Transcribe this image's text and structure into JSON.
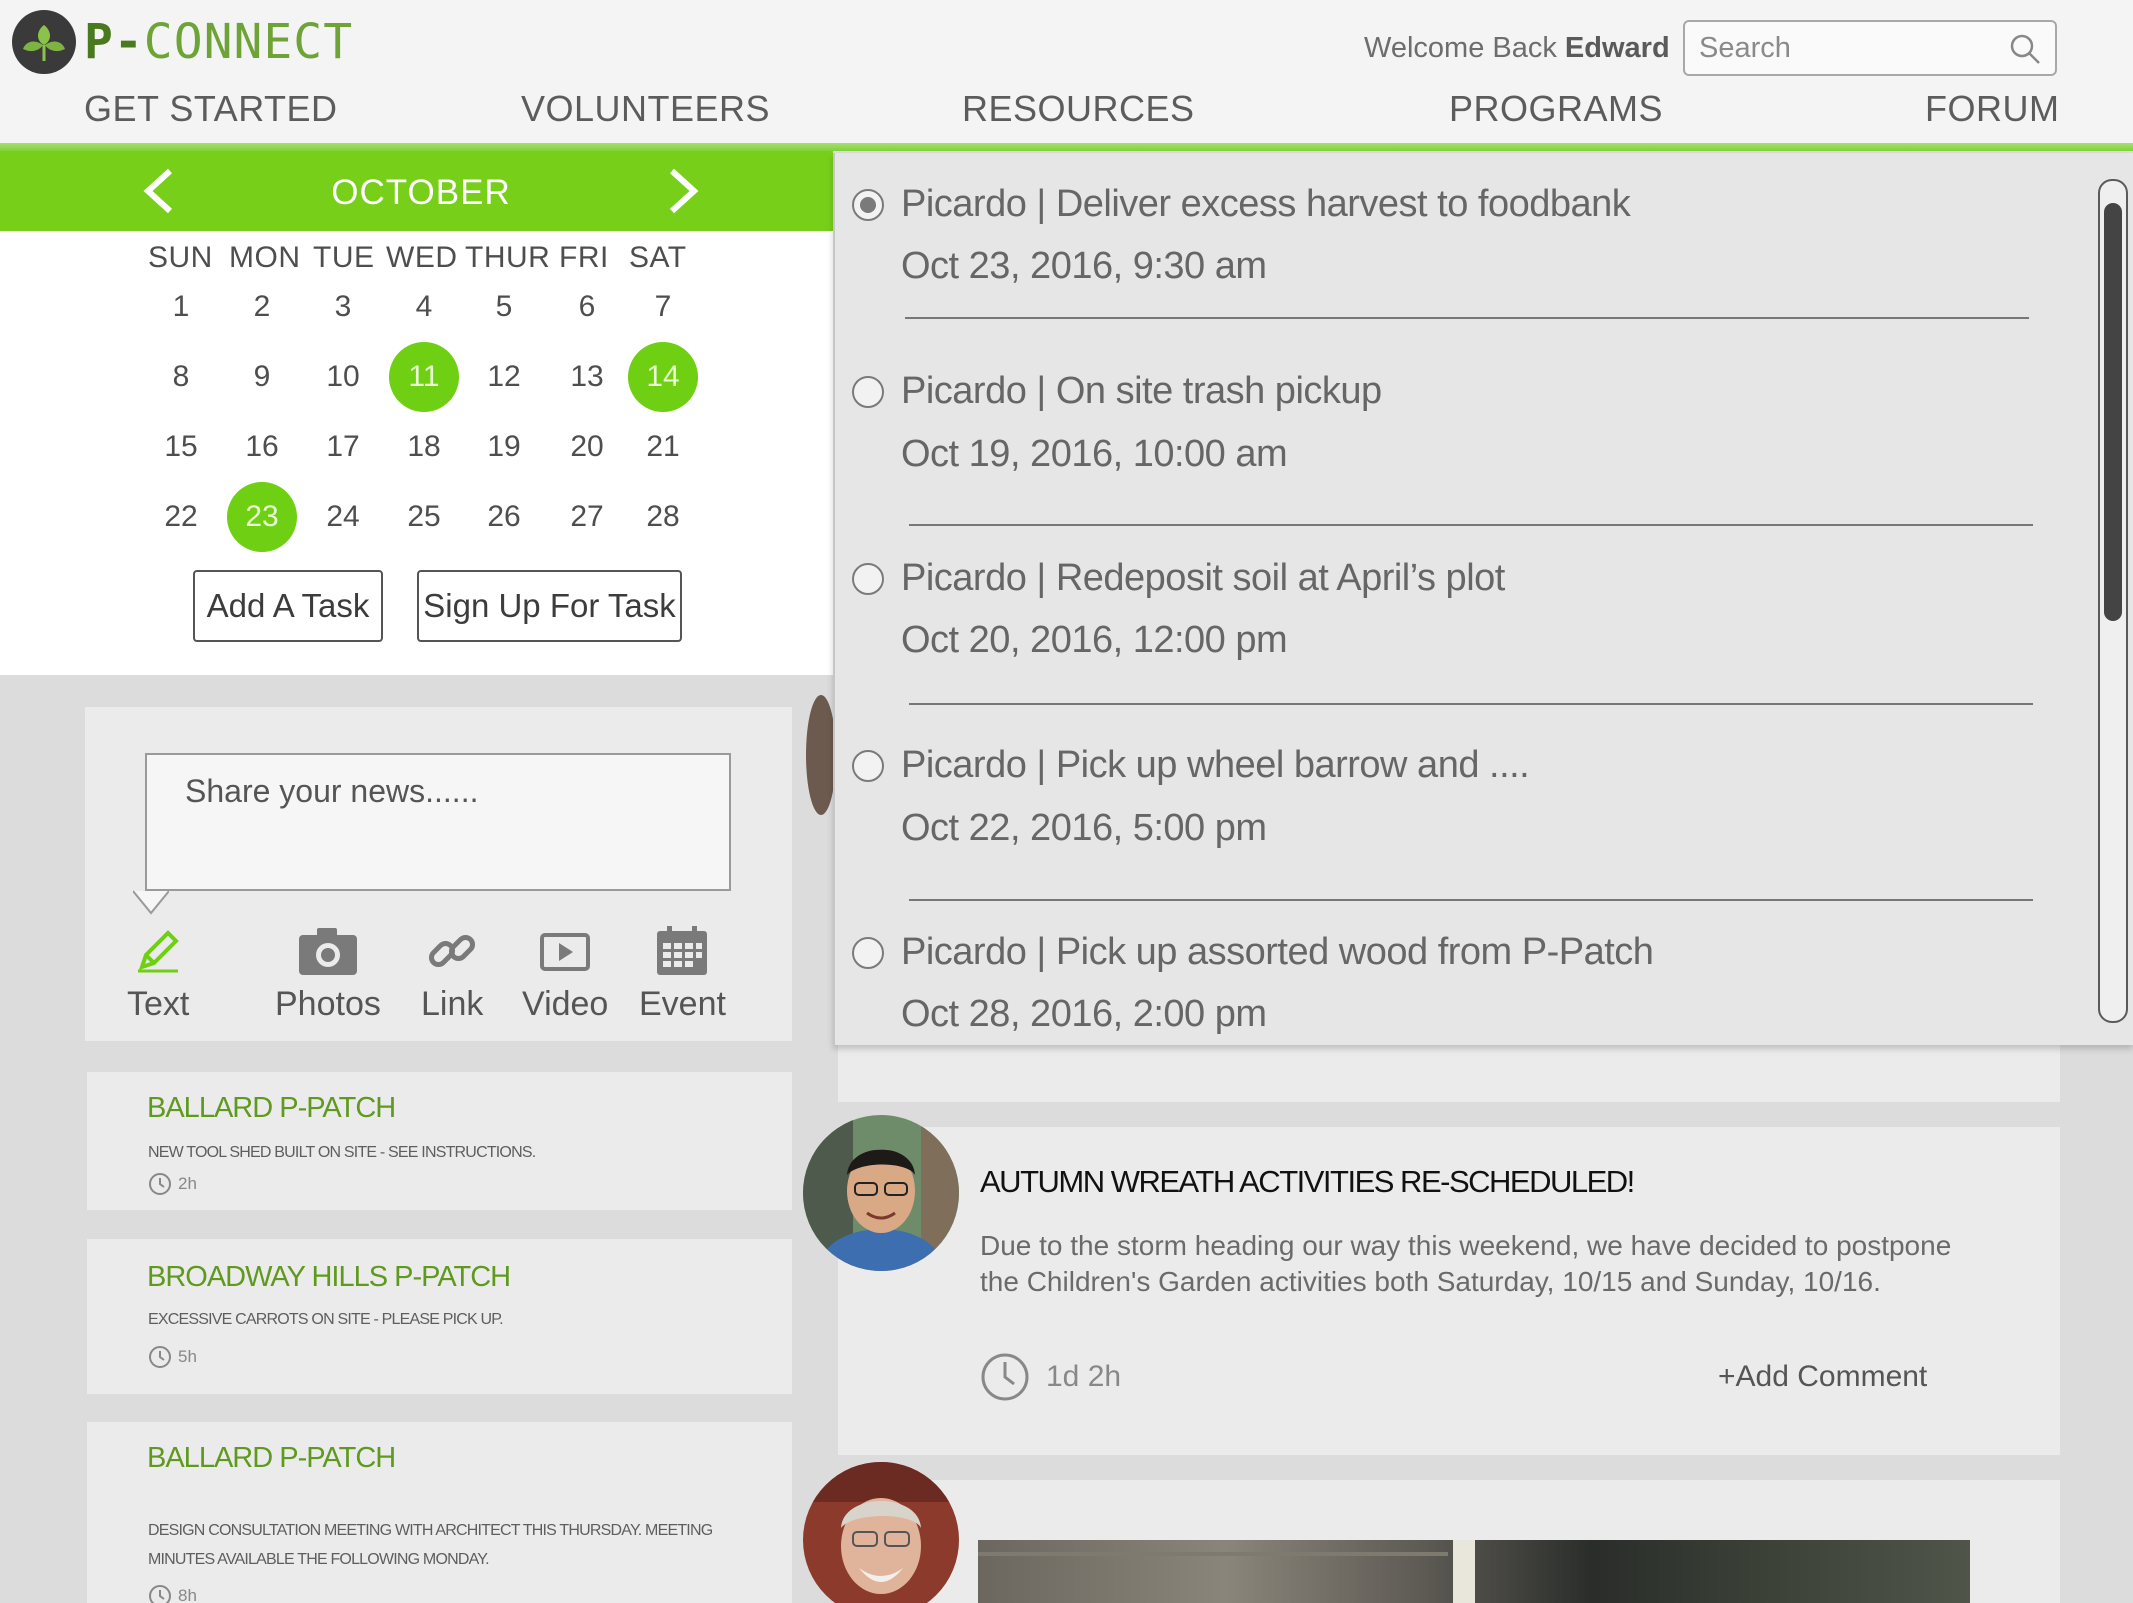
{
  "brand": {
    "name_prefix": "P-",
    "name_rest": "CONNECT",
    "logo_icon": "leaf-icon",
    "accent": "#77cf1a"
  },
  "header": {
    "welcome_prefix": "Welcome Back ",
    "user_name": "Edward",
    "search_placeholder": "Search",
    "nav": [
      "GET STARTED",
      "VOLUNTEERS",
      "RESOURCES",
      "PROGRAMS",
      "FORUM"
    ]
  },
  "calendar": {
    "month": "OCTOBER",
    "weekdays": [
      "SUN",
      "MON",
      "TUE",
      "WED",
      "THUR",
      "FRI",
      "SAT"
    ],
    "weeks": [
      [
        "1",
        "2",
        "3",
        "4",
        "5",
        "6",
        "7"
      ],
      [
        "8",
        "9",
        "10",
        "11",
        "12",
        "13",
        "14"
      ],
      [
        "15",
        "16",
        "17",
        "18",
        "19",
        "20",
        "21"
      ],
      [
        "22",
        "23",
        "24",
        "25",
        "26",
        "27",
        "28"
      ]
    ],
    "highlighted_days": [
      "11",
      "14",
      "23"
    ],
    "add_task_label": "Add A Task",
    "sign_up_label": "Sign Up For Task"
  },
  "composer": {
    "placeholder": "Share your news......",
    "actions": [
      {
        "label": "Text",
        "icon": "pencil-icon"
      },
      {
        "label": "Photos",
        "icon": "camera-icon"
      },
      {
        "label": "Link",
        "icon": "link-icon"
      },
      {
        "label": "Video",
        "icon": "video-icon"
      },
      {
        "label": "Event",
        "icon": "calendar-icon"
      }
    ]
  },
  "news": [
    {
      "title": "BALLARD P-PATCH",
      "body": "NEW TOOL SHED BUILT ON SITE - SEE INSTRUCTIONS.",
      "time": "2h"
    },
    {
      "title": "BROADWAY HILLS P-PATCH",
      "body": "EXCESSIVE CARROTS ON SITE - PLEASE PICK UP.",
      "time": "5h"
    },
    {
      "title": "BALLARD P-PATCH",
      "body": "DESIGN CONSULTATION MEETING WITH ARCHITECT THIS THURSDAY. MEETING MINUTES AVAILABLE THE FOLLOWING MONDAY.",
      "time": "8h"
    }
  ],
  "post": {
    "title": "AUTUMN WREATH ACTIVITIES RE-SCHEDULED!",
    "body": "Due to the storm heading our way this weekend, we have decided to postpone the Children's Garden activities both Saturday, 10/15 and Sunday, 10/16.",
    "time": "1d 2h",
    "add_comment_label": "+Add Comment"
  },
  "tasks": [
    {
      "title": "Picardo | Deliver excess harvest to foodbank",
      "date": "Oct 23, 2016, 9:30 am",
      "selected": true
    },
    {
      "title": "Picardo | On site trash pickup",
      "date": "Oct 19, 2016, 10:00 am",
      "selected": false
    },
    {
      "title": "Picardo | Redeposit soil at April’s plot",
      "date": "Oct 20, 2016, 12:00 pm",
      "selected": false
    },
    {
      "title": "Picardo | Pick up wheel barrow and ....",
      "date": "Oct 22, 2016, 5:00 pm",
      "selected": false
    },
    {
      "title": "Picardo | Pick up assorted wood from P-Patch",
      "date": "Oct 28, 2016, 2:00 pm",
      "selected": false
    }
  ]
}
